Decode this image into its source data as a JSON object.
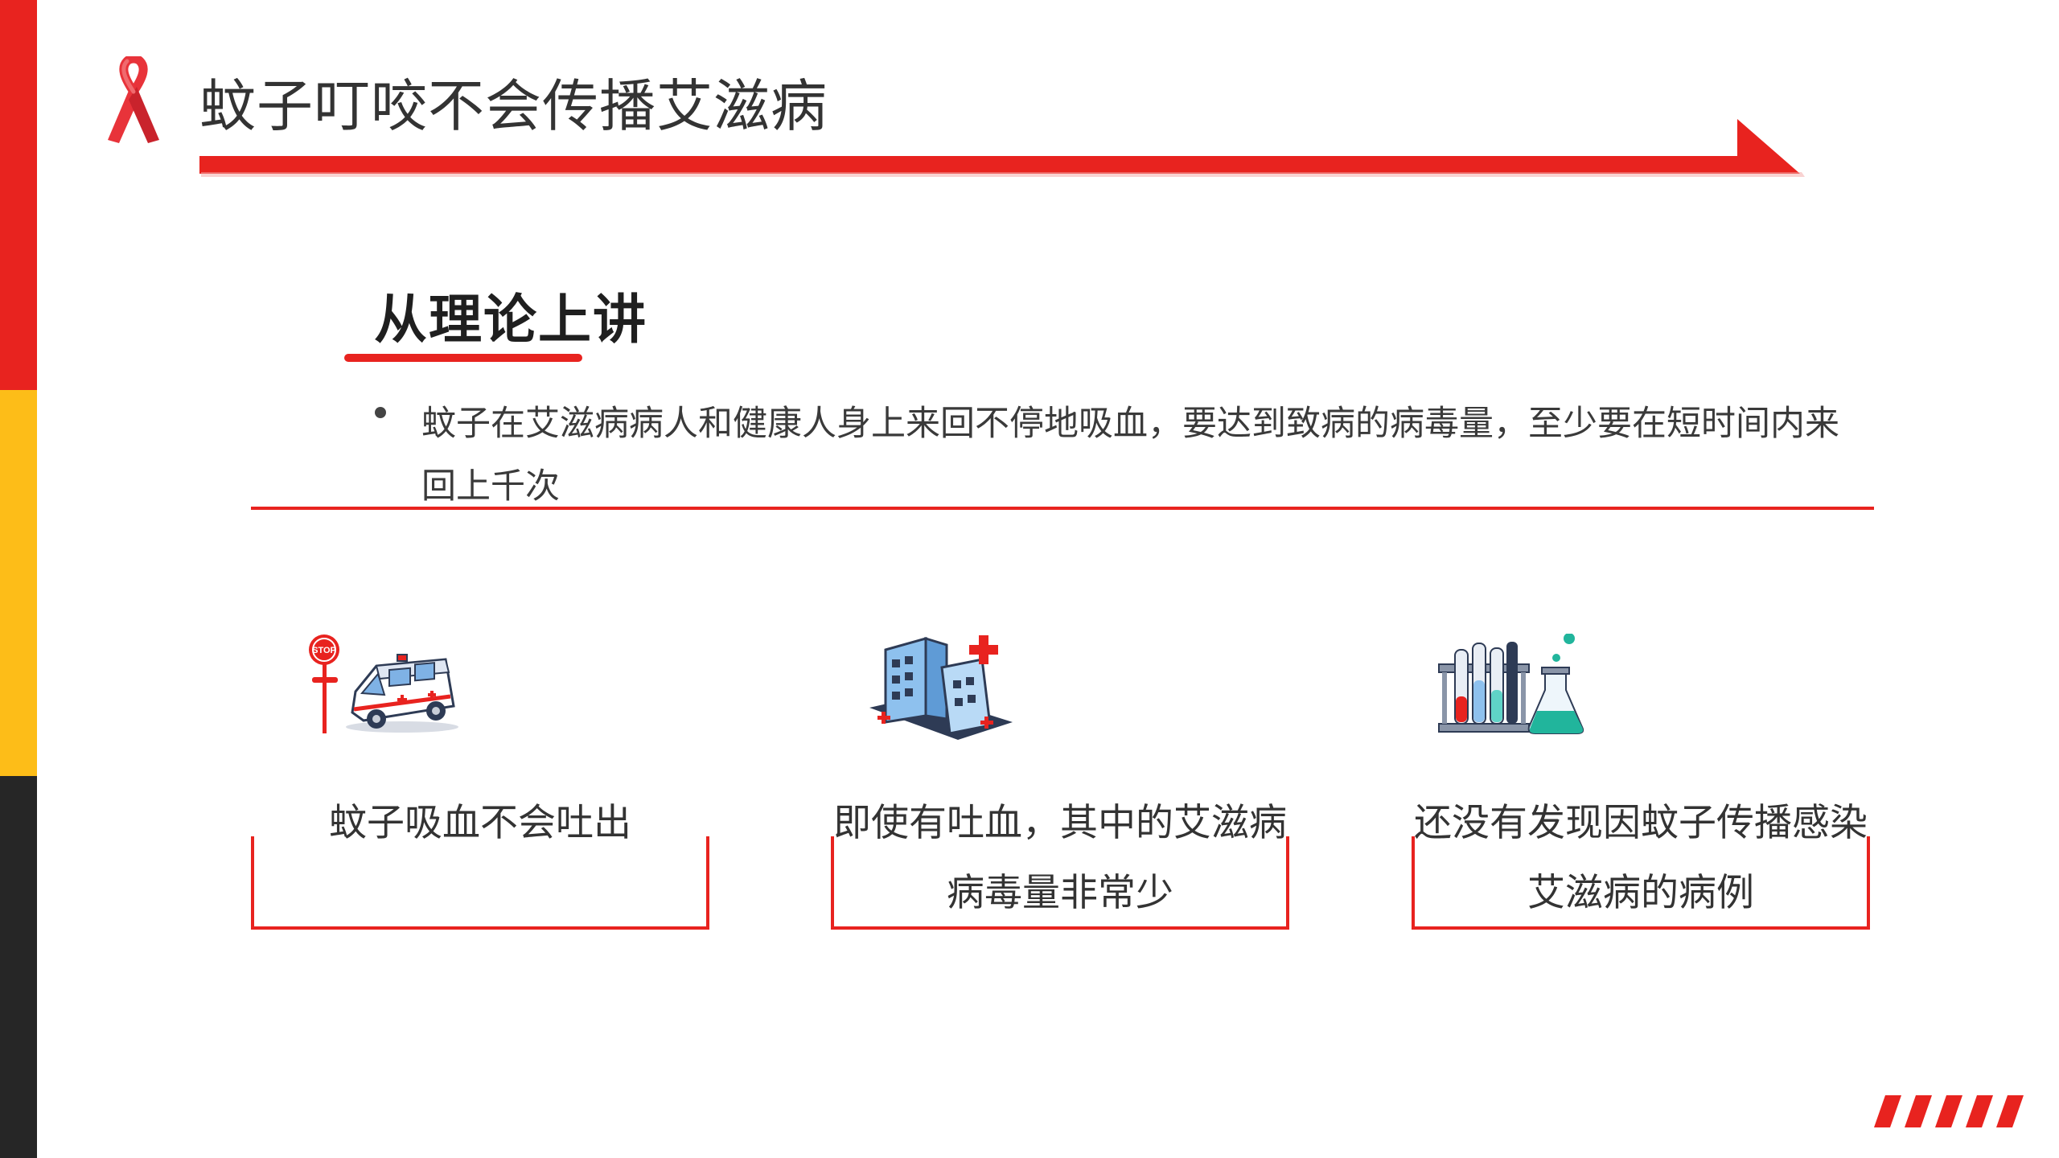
{
  "header": {
    "title": "蚊子叮咬不会传播艾滋病",
    "ribbon_icon": "aids-ribbon-icon",
    "accent_color": "#e8231f"
  },
  "sidebar_colors": [
    "#e8231f",
    "#fdbd18",
    "#262626"
  ],
  "section": {
    "heading": "从理论上讲",
    "bullet": "蚊子在艾滋病病人和健康人身上来回不停地吸血，要达到致病的病毒量，至少要在短时间内来回上千次"
  },
  "cards": [
    {
      "icon": "ambulance-icon",
      "label": "蚊子吸血不会吐出"
    },
    {
      "icon": "hospital-icon",
      "label": "即使有吐血，其中的艾滋病病毒量非常少"
    },
    {
      "icon": "lab-test-tubes-icon",
      "label": "还没有发现因蚊子传播感染艾滋病的病例"
    }
  ],
  "decor": {
    "stripes_icon": "slash-stripes-icon"
  }
}
